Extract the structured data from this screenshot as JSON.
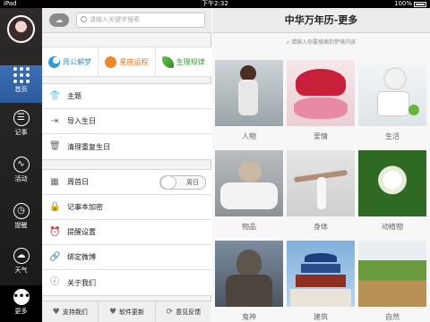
{
  "status": {
    "carrier": "iPad",
    "time": "下午2:32",
    "battery": "100%"
  },
  "sidebar": {
    "items": [
      {
        "label": "首页"
      },
      {
        "label": "记事"
      },
      {
        "label": "活动"
      },
      {
        "label": "提醒"
      },
      {
        "label": "天气"
      },
      {
        "label": "更多"
      }
    ]
  },
  "search": {
    "placeholder": "请输入关键字搜索"
  },
  "tabs": [
    {
      "label": "周公解梦"
    },
    {
      "label": "星座运程"
    },
    {
      "label": "生理规律"
    }
  ],
  "settings": {
    "group1": [
      {
        "label": "主题"
      },
      {
        "label": "导入生日"
      },
      {
        "label": "清理重复生日"
      }
    ],
    "group2": [
      {
        "label": "周首日",
        "value": "周日"
      },
      {
        "label": "记事本加密"
      },
      {
        "label": "提醒设置"
      },
      {
        "label": "绑定微博"
      },
      {
        "label": "关于我们"
      }
    ]
  },
  "footer": {
    "support": "支持我们",
    "update": "软件更新",
    "feedback": "意见反馈"
  },
  "content": {
    "title": "中华万年历-更多",
    "dream_search": "请输入你要搜索的梦境内容",
    "categories": [
      {
        "label": "人物"
      },
      {
        "label": "爱情"
      },
      {
        "label": "生活"
      },
      {
        "label": "物品"
      },
      {
        "label": "身体"
      },
      {
        "label": "动植物"
      },
      {
        "label": "鬼神"
      },
      {
        "label": "建筑"
      },
      {
        "label": "自然"
      }
    ]
  },
  "colors": {
    "accent_blue": "#2f9bd6",
    "accent_orange": "#e1782a",
    "accent_green": "#3c9c35",
    "sidebar_dark": "#2d2a29"
  }
}
